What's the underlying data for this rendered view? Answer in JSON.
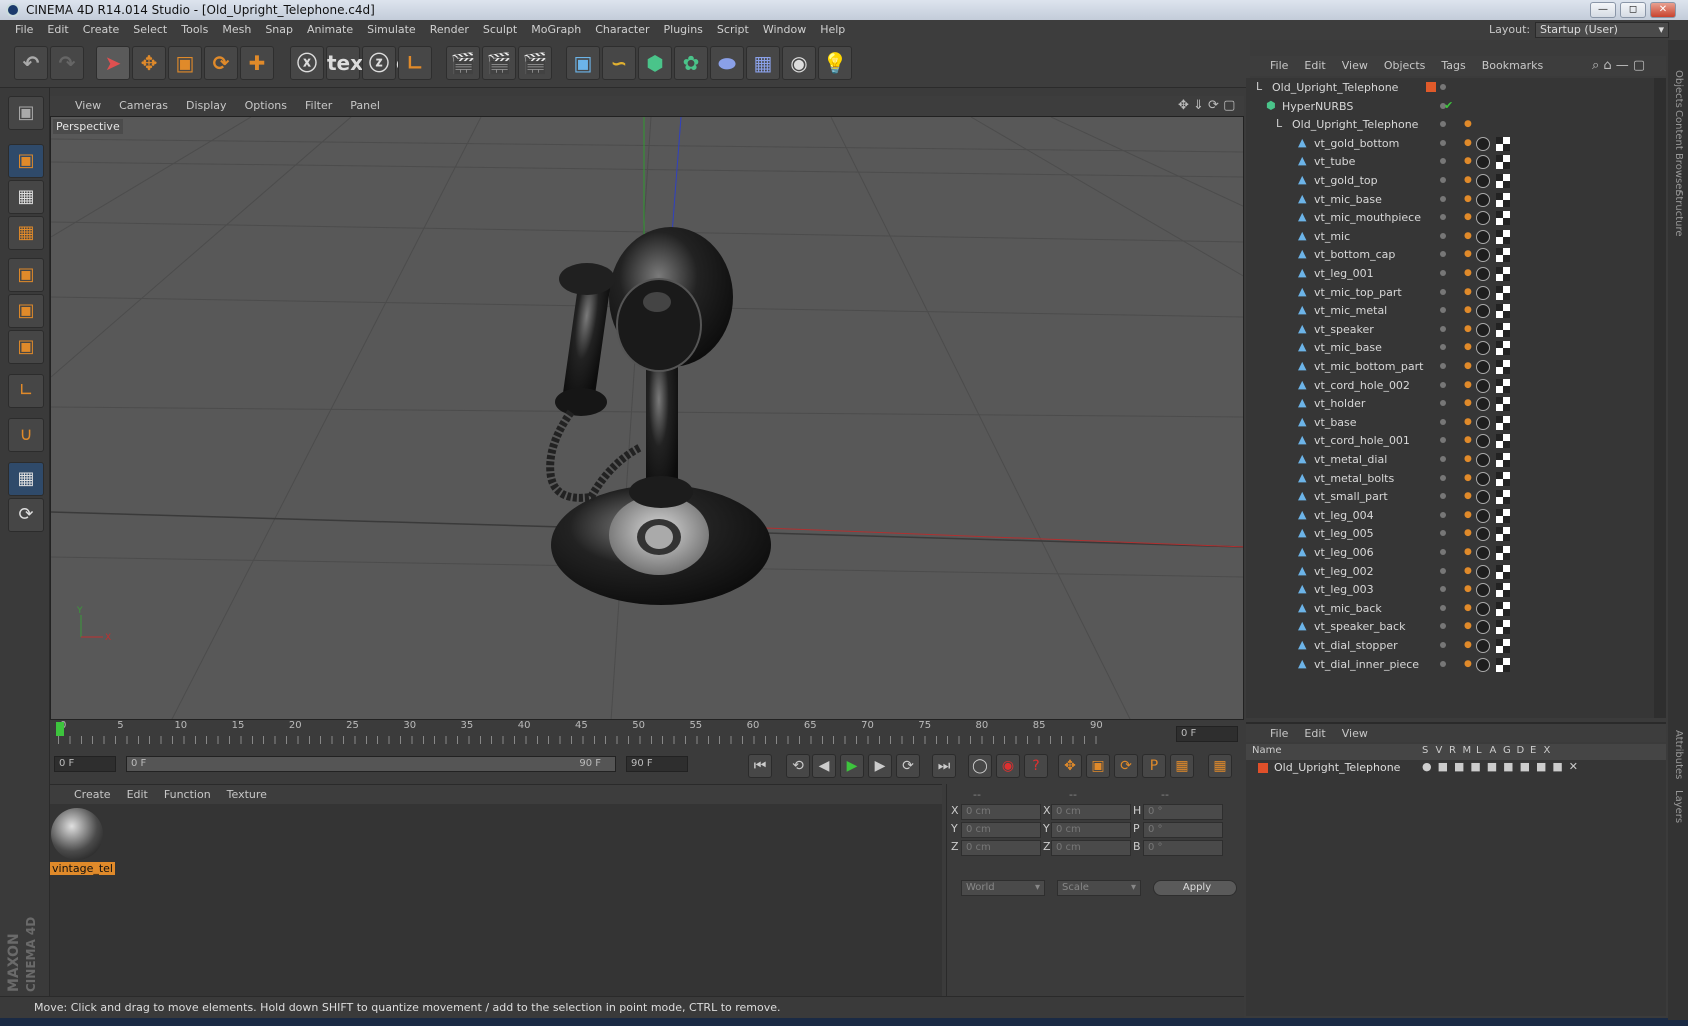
{
  "window": {
    "title": "CINEMA 4D R14.014 Studio - [Old_Upright_Telephone.c4d]"
  },
  "menubar": {
    "items": [
      "File",
      "Edit",
      "Create",
      "Select",
      "Tools",
      "Mesh",
      "Snap",
      "Animate",
      "Simulate",
      "Render",
      "Sculpt",
      "MoGraph",
      "Character",
      "Plugins",
      "Script",
      "Window",
      "Help"
    ],
    "layout_label": "Layout:",
    "layout_value": "Startup (User)"
  },
  "viewport": {
    "menu": [
      "View",
      "Cameras",
      "Display",
      "Options",
      "Filter",
      "Panel"
    ],
    "label": "Perspective",
    "axis_y": "Y",
    "axis_x": "X"
  },
  "timeline": {
    "ticks": [
      "0",
      "5",
      "10",
      "15",
      "20",
      "25",
      "30",
      "35",
      "40",
      "45",
      "50",
      "55",
      "60",
      "65",
      "70",
      "75",
      "80",
      "85",
      "90"
    ],
    "frame_field": "0 F",
    "start_field": "0 F",
    "range_start": "0 F",
    "range_end": "90 F",
    "end_field": "90 F"
  },
  "materials": {
    "menu": [
      "Create",
      "Edit",
      "Function",
      "Texture"
    ],
    "items": [
      {
        "label": "vintage_tel"
      }
    ]
  },
  "coordinates": {
    "headers": [
      "--",
      "--",
      "--"
    ],
    "rows": [
      {
        "l1": "X",
        "v1": "0 cm",
        "l2": "X",
        "v2": "0 cm",
        "l3": "H",
        "v3": "0 °"
      },
      {
        "l1": "Y",
        "v1": "0 cm",
        "l2": "Y",
        "v2": "0 cm",
        "l3": "P",
        "v3": "0 °"
      },
      {
        "l1": "Z",
        "v1": "0 cm",
        "l2": "Z",
        "v2": "0 cm",
        "l3": "B",
        "v3": "0 °"
      }
    ],
    "mode1": "World",
    "mode2": "Scale",
    "apply": "Apply"
  },
  "objects": {
    "menu": [
      "File",
      "Edit",
      "View",
      "Objects",
      "Tags",
      "Bookmarks"
    ],
    "tree": [
      {
        "name": "Old_Upright_Telephone",
        "level": 0,
        "type": "null"
      },
      {
        "name": "HyperNURBS",
        "level": 1,
        "type": "nurbs"
      },
      {
        "name": "Old_Upright_Telephone",
        "level": 2,
        "type": "null"
      },
      {
        "name": "vt_gold_bottom",
        "level": 3,
        "type": "mesh"
      },
      {
        "name": "vt_tube",
        "level": 3,
        "type": "mesh"
      },
      {
        "name": "vt_gold_top",
        "level": 3,
        "type": "mesh"
      },
      {
        "name": "vt_mic_base",
        "level": 3,
        "type": "mesh"
      },
      {
        "name": "vt_mic_mouthpiece",
        "level": 3,
        "type": "mesh"
      },
      {
        "name": "vt_mic",
        "level": 3,
        "type": "mesh"
      },
      {
        "name": "vt_bottom_cap",
        "level": 3,
        "type": "mesh"
      },
      {
        "name": "vt_leg_001",
        "level": 3,
        "type": "mesh"
      },
      {
        "name": "vt_mic_top_part",
        "level": 3,
        "type": "mesh"
      },
      {
        "name": "vt_mic_metal",
        "level": 3,
        "type": "mesh"
      },
      {
        "name": "vt_speaker",
        "level": 3,
        "type": "mesh"
      },
      {
        "name": "vt_mic_base",
        "level": 3,
        "type": "mesh"
      },
      {
        "name": "vt_mic_bottom_part",
        "level": 3,
        "type": "mesh"
      },
      {
        "name": "vt_cord_hole_002",
        "level": 3,
        "type": "mesh"
      },
      {
        "name": "vt_holder",
        "level": 3,
        "type": "mesh"
      },
      {
        "name": "vt_base",
        "level": 3,
        "type": "mesh"
      },
      {
        "name": "vt_cord_hole_001",
        "level": 3,
        "type": "mesh"
      },
      {
        "name": "vt_metal_dial",
        "level": 3,
        "type": "mesh"
      },
      {
        "name": "vt_metal_bolts",
        "level": 3,
        "type": "mesh"
      },
      {
        "name": "vt_small_part",
        "level": 3,
        "type": "mesh"
      },
      {
        "name": "vt_leg_004",
        "level": 3,
        "type": "mesh"
      },
      {
        "name": "vt_leg_005",
        "level": 3,
        "type": "mesh"
      },
      {
        "name": "vt_leg_006",
        "level": 3,
        "type": "mesh"
      },
      {
        "name": "vt_leg_002",
        "level": 3,
        "type": "mesh"
      },
      {
        "name": "vt_leg_003",
        "level": 3,
        "type": "mesh"
      },
      {
        "name": "vt_mic_back",
        "level": 3,
        "type": "mesh"
      },
      {
        "name": "vt_speaker_back",
        "level": 3,
        "type": "mesh"
      },
      {
        "name": "vt_dial_stopper",
        "level": 3,
        "type": "mesh"
      },
      {
        "name": "vt_dial_inner_piece",
        "level": 3,
        "type": "mesh"
      }
    ]
  },
  "layers": {
    "menu": [
      "File",
      "Edit",
      "View"
    ],
    "columns": [
      "Name",
      "S",
      "V",
      "R",
      "M",
      "L",
      "A",
      "G",
      "D",
      "E",
      "X"
    ],
    "rows": [
      {
        "name": "Old_Upright_Telephone"
      }
    ]
  },
  "side_tabs": [
    "Objects",
    "Content Browser",
    "Structure",
    "Attributes",
    "Layers"
  ],
  "status": "Move: Click and drag to move elements. Hold down SHIFT to quantize movement / add to the selection in point mode, CTRL to remove.",
  "brand": {
    "line1": "MAXON",
    "line2": "CINEMA 4D"
  },
  "colors": {
    "accent": "#e08a2a",
    "selection": "#2f4a6a",
    "grid_bg": "#585858"
  }
}
